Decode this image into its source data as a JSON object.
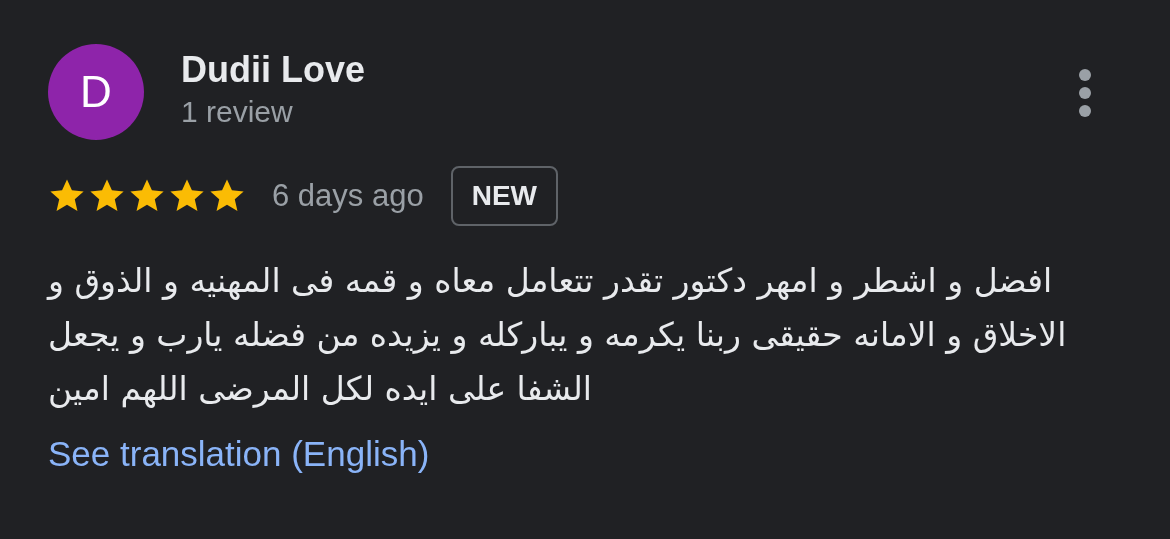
{
  "reviewer": {
    "avatar_letter": "D",
    "name": "Dudii Love",
    "review_count": "1 review"
  },
  "rating": {
    "stars": 5
  },
  "date": "6 days ago",
  "badge": "NEW",
  "review_text": "افضل و اشطر و امهر دكتور تقدر تتعامل معاه و قمه فى المهنيه و الذوق و الاخلاق و الامانه حقيقى ربنا يكرمه و يباركله و يزيده من فضله يارب و يجعل الشفا على ايده لكل المرضى اللهم امين",
  "translation_link": "See translation (English)"
}
